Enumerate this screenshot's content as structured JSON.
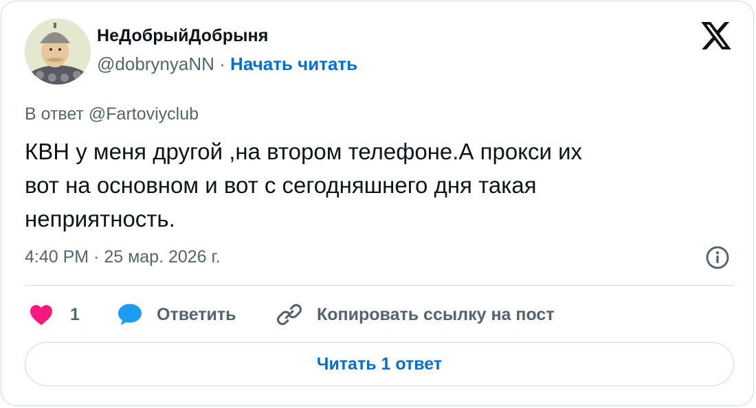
{
  "author": {
    "display_name": "НеДобрыйДобрыня",
    "handle": "@dobrynyaNN",
    "separator": "·",
    "follow_label": "Начать читать"
  },
  "tweet": {
    "reply_to": "В ответ @Fartoviyclub",
    "lines": [
      "КВН у меня другой ,на втором телефоне.А прокси их",
      "вот на основном и вот с сегодняшнего дня такая",
      "неприятность."
    ],
    "timestamp": "4:40 PM · 25 мар. 2026 г."
  },
  "actions": {
    "like_count": "1",
    "reply_label": "Ответить",
    "copy_link_label": "Копировать ссылку на пост"
  },
  "read_replies_label": "Читать 1 ответ",
  "icons": {
    "brand": "x-logo-icon",
    "info": "info-icon",
    "like": "heart-icon",
    "reply": "speech-bubble-icon",
    "copy": "link-icon"
  },
  "colors": {
    "link": "#006fd6",
    "like": "#f91880",
    "reply": "#1d9bf0",
    "muted": "#536471",
    "text": "#0f1419",
    "border": "#cfd9de"
  }
}
